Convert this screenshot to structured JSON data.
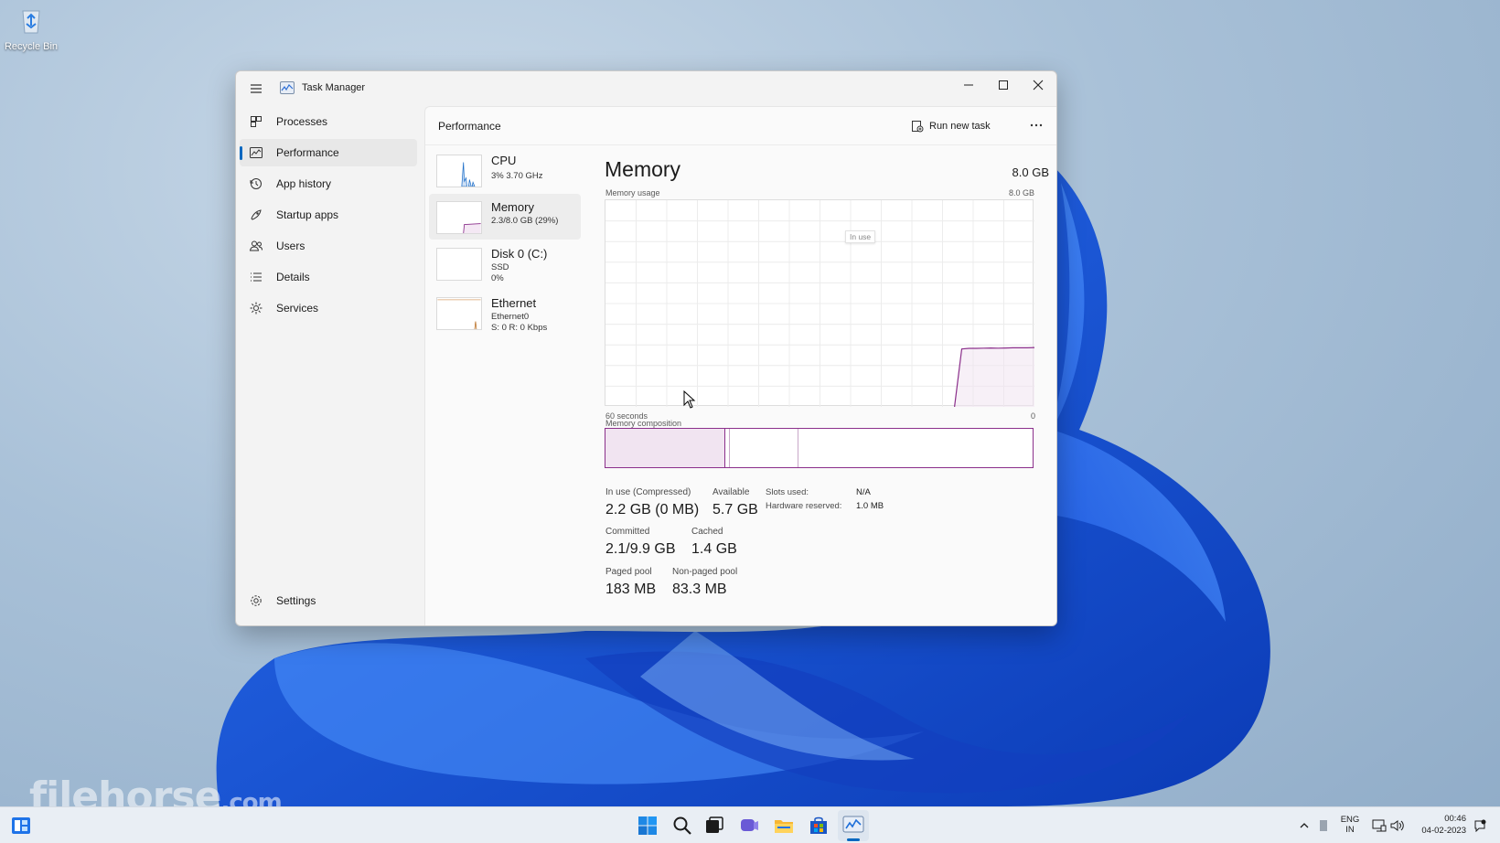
{
  "desktop": {
    "recycle_bin_label": "Recycle Bin",
    "watermark": "filehorse",
    "watermark_suffix": ".com"
  },
  "window": {
    "title": "Task Manager",
    "controls": {
      "minimize": "minimize-icon",
      "maximize": "maximize-icon",
      "close": "close-icon"
    }
  },
  "sidebar": {
    "items": [
      {
        "label": "Processes",
        "icon": "processes-icon"
      },
      {
        "label": "Performance",
        "icon": "performance-icon",
        "active": true
      },
      {
        "label": "App history",
        "icon": "history-icon"
      },
      {
        "label": "Startup apps",
        "icon": "startup-icon"
      },
      {
        "label": "Users",
        "icon": "users-icon"
      },
      {
        "label": "Details",
        "icon": "details-icon"
      },
      {
        "label": "Services",
        "icon": "services-icon"
      }
    ],
    "settings_label": "Settings"
  },
  "header": {
    "title": "Performance",
    "run_new_task": "Run new task"
  },
  "resources": [
    {
      "name": "CPU",
      "lines": [
        "3% 3.70 GHz"
      ]
    },
    {
      "name": "Memory",
      "lines": [
        "2.3/8.0 GB (29%)"
      ],
      "selected": true
    },
    {
      "name": "Disk 0 (C:)",
      "lines": [
        "SSD",
        "0%"
      ]
    },
    {
      "name": "Ethernet",
      "lines": [
        "Ethernet0",
        "S: 0 R: 0 Kbps"
      ]
    }
  ],
  "memory": {
    "title": "Memory",
    "total": "8.0 GB",
    "usage_label": "Memory usage",
    "usage_max": "8.0 GB",
    "tooltip": "In use",
    "axis_left": "60 seconds",
    "axis_right": "0",
    "composition_label": "Memory composition",
    "composition": {
      "in_use_fraction": 0.28,
      "modified_fraction": 0.01,
      "standby_fraction": 0.16
    },
    "usage_series": [
      0,
      0,
      0,
      0,
      0,
      0,
      0,
      0,
      0,
      0,
      0,
      0,
      0,
      0,
      0,
      0,
      0,
      0,
      0,
      0,
      0,
      0,
      0,
      0,
      0,
      0,
      0,
      0,
      0,
      0,
      0,
      0,
      0,
      0,
      0,
      0,
      0,
      0,
      0,
      0,
      0,
      0,
      0,
      0,
      0,
      0,
      0,
      0,
      0,
      0.28,
      0.283,
      0.283,
      0.284,
      0.285,
      0.284,
      0.285,
      0.286,
      0.286,
      0.286,
      0.287
    ],
    "stats": {
      "in_use_label": "In use (Compressed)",
      "in_use_value": "2.2 GB (0 MB)",
      "available_label": "Available",
      "available_value": "5.7 GB",
      "committed_label": "Committed",
      "committed_value": "2.1/9.9 GB",
      "cached_label": "Cached",
      "cached_value": "1.4 GB",
      "paged_label": "Paged pool",
      "paged_value": "183 MB",
      "nonpaged_label": "Non-paged pool",
      "nonpaged_value": "83.3 MB",
      "slots_label": "Slots used:",
      "slots_value": "N/A",
      "hw_label": "Hardware reserved:",
      "hw_value": "1.0 MB"
    }
  },
  "taskbar": {
    "language_top": "ENG",
    "language_bottom": "IN",
    "time": "00:46",
    "date": "04-02-2023"
  },
  "colors": {
    "memory_accent": "#8b2f8b",
    "memory_fill": "#f1e4f1",
    "accent": "#0067c0"
  }
}
